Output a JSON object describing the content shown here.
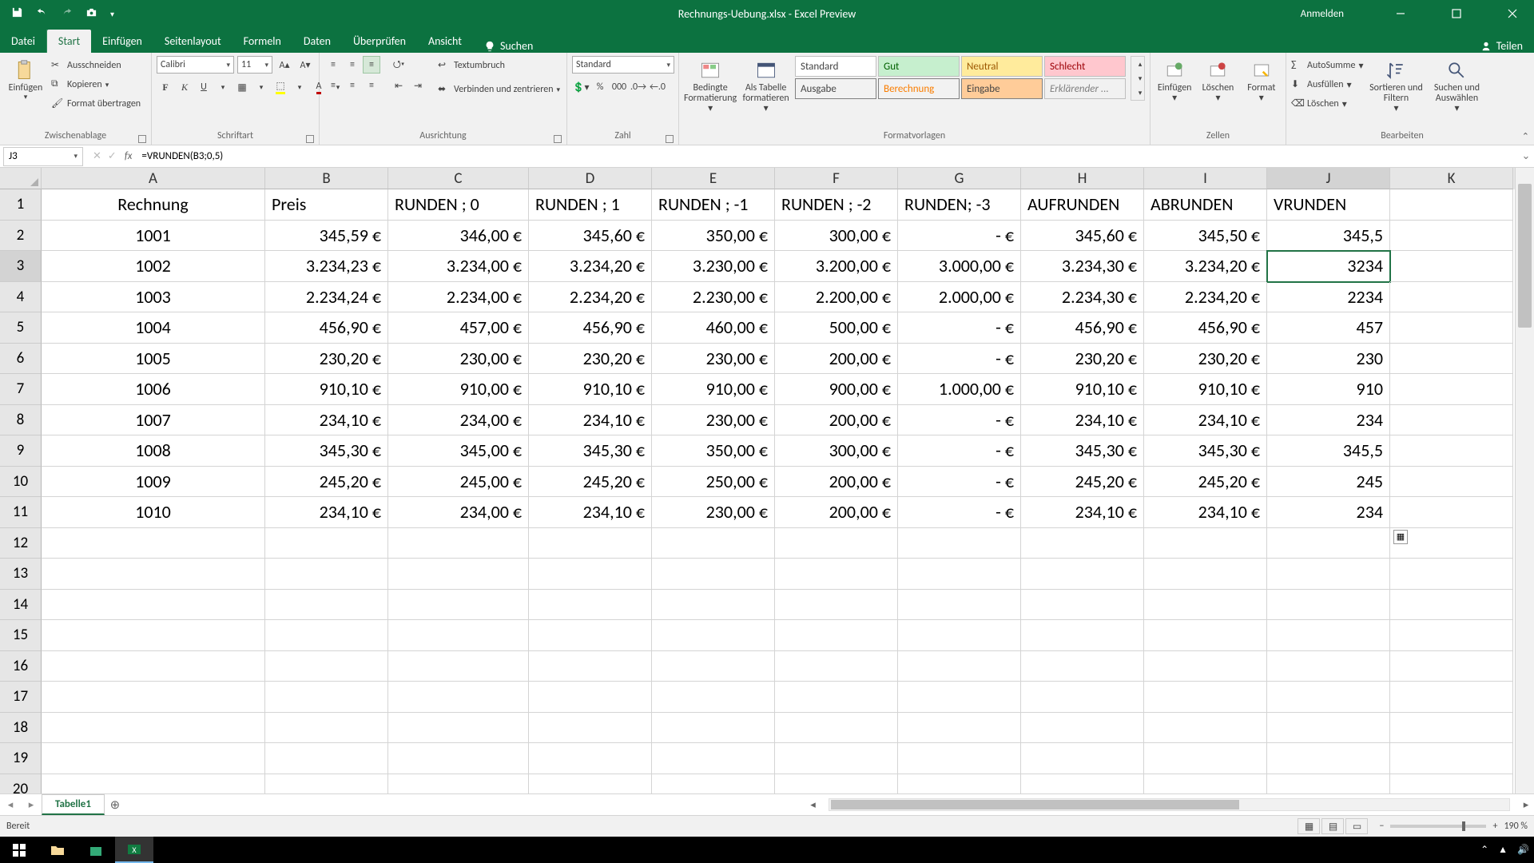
{
  "title": "Rechnungs-Uebung.xlsx - Excel Preview",
  "signin": "Anmelden",
  "tabs": {
    "file": "Datei",
    "home": "Start",
    "insert": "Einfügen",
    "layout": "Seitenlayout",
    "formulas": "Formeln",
    "data": "Daten",
    "review": "Überprüfen",
    "view": "Ansicht",
    "search": "Suchen",
    "share": "Teilen"
  },
  "ribbon": {
    "clipboard": {
      "label": "Zwischenablage",
      "paste": "Einfügen",
      "cut": "Ausschneiden",
      "copy": "Kopieren",
      "painter": "Format übertragen"
    },
    "font": {
      "label": "Schriftart",
      "name": "Calibri",
      "size": "11"
    },
    "align": {
      "label": "Ausrichtung",
      "wrap": "Textumbruch",
      "merge": "Verbinden und zentrieren"
    },
    "number": {
      "label": "Zahl",
      "format": "Standard"
    },
    "styles": {
      "label": "Formatvorlagen",
      "cond": "Bedingte Formatierung",
      "table": "Als Tabelle formatieren",
      "s1": "Standard",
      "s2": "Gut",
      "s3": "Neutral",
      "s4": "Schlecht",
      "s5": "Ausgabe",
      "s6": "Berechnung",
      "s7": "Eingabe",
      "s8": "Erklärender ..."
    },
    "cells": {
      "label": "Zellen",
      "insert": "Einfügen",
      "delete": "Löschen",
      "format": "Format"
    },
    "editing": {
      "label": "Bearbeiten",
      "autosum": "AutoSumme",
      "fill": "Ausfüllen",
      "clear": "Löschen",
      "sort": "Sortieren und Filtern",
      "find": "Suchen und Auswählen"
    }
  },
  "fbar": {
    "name": "J3",
    "formula": "=VRUNDEN(B3;0,5)"
  },
  "columns": [
    "A",
    "B",
    "C",
    "D",
    "E",
    "F",
    "G",
    "H",
    "I",
    "J",
    "K"
  ],
  "headers": [
    "Rechnung",
    "Preis",
    "RUNDEN ; 0",
    "RUNDEN ; 1",
    "RUNDEN ; -1",
    "RUNDEN ; -2",
    "RUNDEN; -3",
    "AUFRUNDEN",
    "ABRUNDEN",
    "VRUNDEN",
    ""
  ],
  "data": [
    [
      "1001",
      "345,59 €",
      "346,00 €",
      "345,60 €",
      "350,00 €",
      "300,00 €",
      "-   €",
      "345,60 €",
      "345,50 €",
      "345,5",
      ""
    ],
    [
      "1002",
      "3.234,23 €",
      "3.234,00 €",
      "3.234,20 €",
      "3.230,00 €",
      "3.200,00 €",
      "3.000,00 €",
      "3.234,30 €",
      "3.234,20 €",
      "3234",
      ""
    ],
    [
      "1003",
      "2.234,24 €",
      "2.234,00 €",
      "2.234,20 €",
      "2.230,00 €",
      "2.200,00 €",
      "2.000,00 €",
      "2.234,30 €",
      "2.234,20 €",
      "2234",
      ""
    ],
    [
      "1004",
      "456,90 €",
      "457,00 €",
      "456,90 €",
      "460,00 €",
      "500,00 €",
      "-   €",
      "456,90 €",
      "456,90 €",
      "457",
      ""
    ],
    [
      "1005",
      "230,20 €",
      "230,00 €",
      "230,20 €",
      "230,00 €",
      "200,00 €",
      "-   €",
      "230,20 €",
      "230,20 €",
      "230",
      ""
    ],
    [
      "1006",
      "910,10 €",
      "910,00 €",
      "910,10 €",
      "910,00 €",
      "900,00 €",
      "1.000,00 €",
      "910,10 €",
      "910,10 €",
      "910",
      ""
    ],
    [
      "1007",
      "234,10 €",
      "234,00 €",
      "234,10 €",
      "230,00 €",
      "200,00 €",
      "-   €",
      "234,10 €",
      "234,10 €",
      "234",
      ""
    ],
    [
      "1008",
      "345,30 €",
      "345,00 €",
      "345,30 €",
      "350,00 €",
      "300,00 €",
      "-   €",
      "345,30 €",
      "345,30 €",
      "345,5",
      ""
    ],
    [
      "1009",
      "245,20 €",
      "245,00 €",
      "245,20 €",
      "250,00 €",
      "200,00 €",
      "-   €",
      "245,20 €",
      "245,20 €",
      "245",
      ""
    ],
    [
      "1010",
      "234,10 €",
      "234,00 €",
      "234,10 €",
      "230,00 €",
      "200,00 €",
      "-   €",
      "234,10 €",
      "234,10 €",
      "234",
      ""
    ]
  ],
  "selected": {
    "row": 3,
    "col": "J"
  },
  "sheet": {
    "name": "Tabelle1"
  },
  "status": {
    "ready": "Bereit",
    "zoom": "190 %"
  }
}
